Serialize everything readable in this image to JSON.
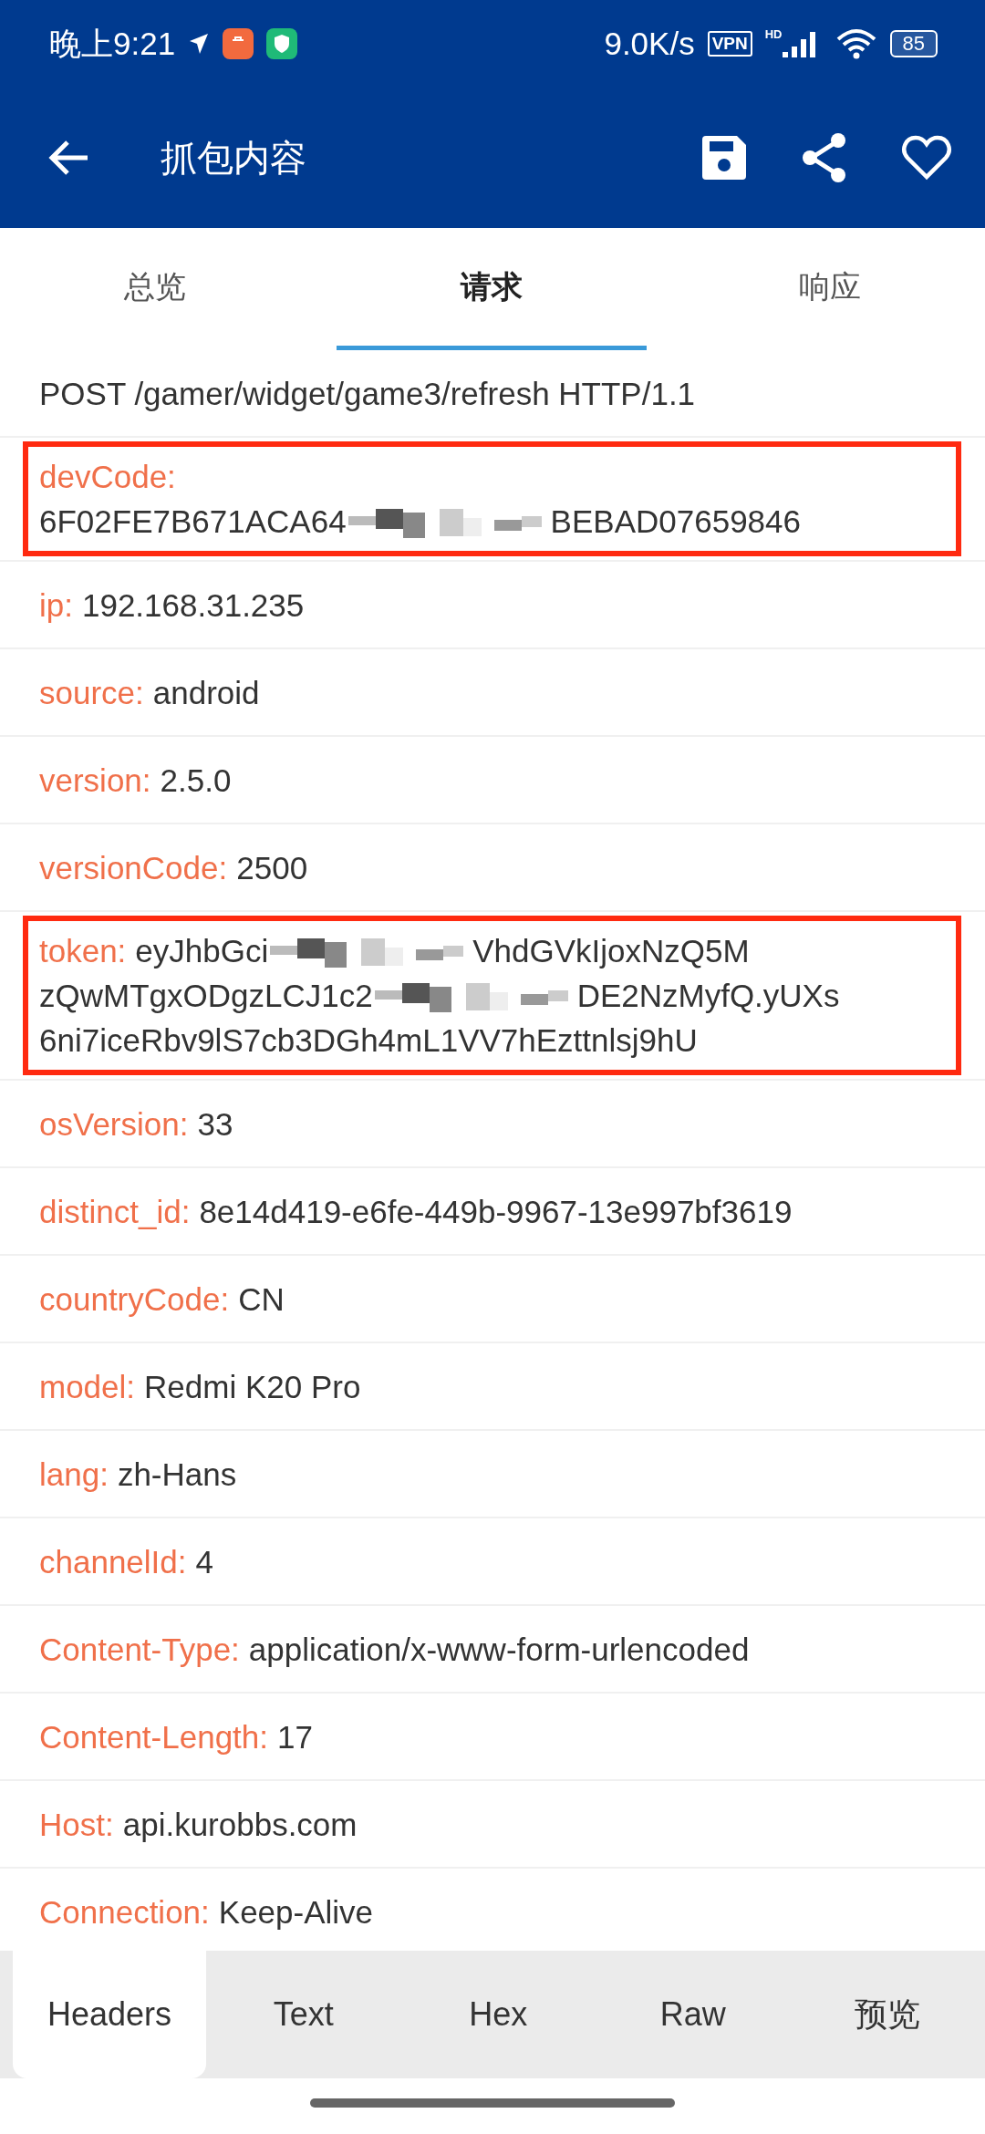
{
  "status_bar": {
    "time": "晚上9:21",
    "speed": "9.0K/s",
    "vpn": "VPN",
    "network": "HD",
    "battery": "85"
  },
  "app_bar": {
    "title": "抓包内容"
  },
  "tabs": [
    {
      "label": "总览",
      "selected": false
    },
    {
      "label": "请求",
      "selected": true
    },
    {
      "label": "响应",
      "selected": false
    }
  ],
  "request_line": "POST /gamer/widget/game3/refresh HTTP/1.1",
  "headers": [
    {
      "key": "devCode:",
      "highlighted": true,
      "value": [
        {
          "kind": "break"
        },
        {
          "kind": "text",
          "text": "6F02FE7B671ACA64"
        },
        {
          "kind": "redacted"
        },
        {
          "kind": "text",
          "text": "BEBAD07659846"
        }
      ]
    },
    {
      "key": "ip:",
      "highlighted": false,
      "value": [
        {
          "kind": "text",
          "text": "192.168.31.235"
        }
      ]
    },
    {
      "key": "source:",
      "highlighted": false,
      "value": [
        {
          "kind": "text",
          "text": "android"
        }
      ]
    },
    {
      "key": "version:",
      "highlighted": false,
      "value": [
        {
          "kind": "text",
          "text": "2.5.0"
        }
      ]
    },
    {
      "key": "versionCode:",
      "highlighted": false,
      "value": [
        {
          "kind": "text",
          "text": "2500"
        }
      ]
    },
    {
      "key": "token:",
      "highlighted": true,
      "value": [
        {
          "kind": "text",
          "text": "eyJhbGci"
        },
        {
          "kind": "redacted"
        },
        {
          "kind": "text",
          "text": "VhdGVkIjoxNzQ5M"
        },
        {
          "kind": "break"
        },
        {
          "kind": "text",
          "text": "zQwMTgxODgzLCJ1c2"
        },
        {
          "kind": "redacted"
        },
        {
          "kind": "text",
          "text": "DE2NzMyfQ.yUXs"
        },
        {
          "kind": "break"
        },
        {
          "kind": "text",
          "text": "6ni7iceRbv9lS7cb3DGh4mL1VV7hEzttnlsj9hU"
        }
      ]
    },
    {
      "key": "osVersion:",
      "highlighted": false,
      "value": [
        {
          "kind": "text",
          "text": "33"
        }
      ]
    },
    {
      "key": "distinct_id:",
      "highlighted": false,
      "value": [
        {
          "kind": "text",
          "text": "8e14d419-e6fe-449b-9967-13e997bf3619"
        }
      ]
    },
    {
      "key": "countryCode:",
      "highlighted": false,
      "value": [
        {
          "kind": "text",
          "text": "CN"
        }
      ]
    },
    {
      "key": "model:",
      "highlighted": false,
      "value": [
        {
          "kind": "text",
          "text": "Redmi K20 Pro"
        }
      ]
    },
    {
      "key": "lang:",
      "highlighted": false,
      "value": [
        {
          "kind": "text",
          "text": "zh-Hans"
        }
      ]
    },
    {
      "key": "channelId:",
      "highlighted": false,
      "value": [
        {
          "kind": "text",
          "text": "4"
        }
      ]
    },
    {
      "key": "Content-Type:",
      "highlighted": false,
      "value": [
        {
          "kind": "text",
          "text": "application/x-www-form-urlencoded"
        }
      ]
    },
    {
      "key": "Content-Length:",
      "highlighted": false,
      "value": [
        {
          "kind": "text",
          "text": "17"
        }
      ]
    },
    {
      "key": "Host:",
      "highlighted": false,
      "value": [
        {
          "kind": "text",
          "text": "api.kurobbs.com"
        }
      ]
    },
    {
      "key": "Connection:",
      "highlighted": false,
      "value": [
        {
          "kind": "text",
          "text": "Keep-Alive"
        }
      ]
    }
  ],
  "bottom_tabs": [
    {
      "label": "Headers",
      "selected": true
    },
    {
      "label": "Text",
      "selected": false
    },
    {
      "label": "Hex",
      "selected": false
    },
    {
      "label": "Raw",
      "selected": false
    },
    {
      "label": "预览",
      "selected": false
    }
  ]
}
